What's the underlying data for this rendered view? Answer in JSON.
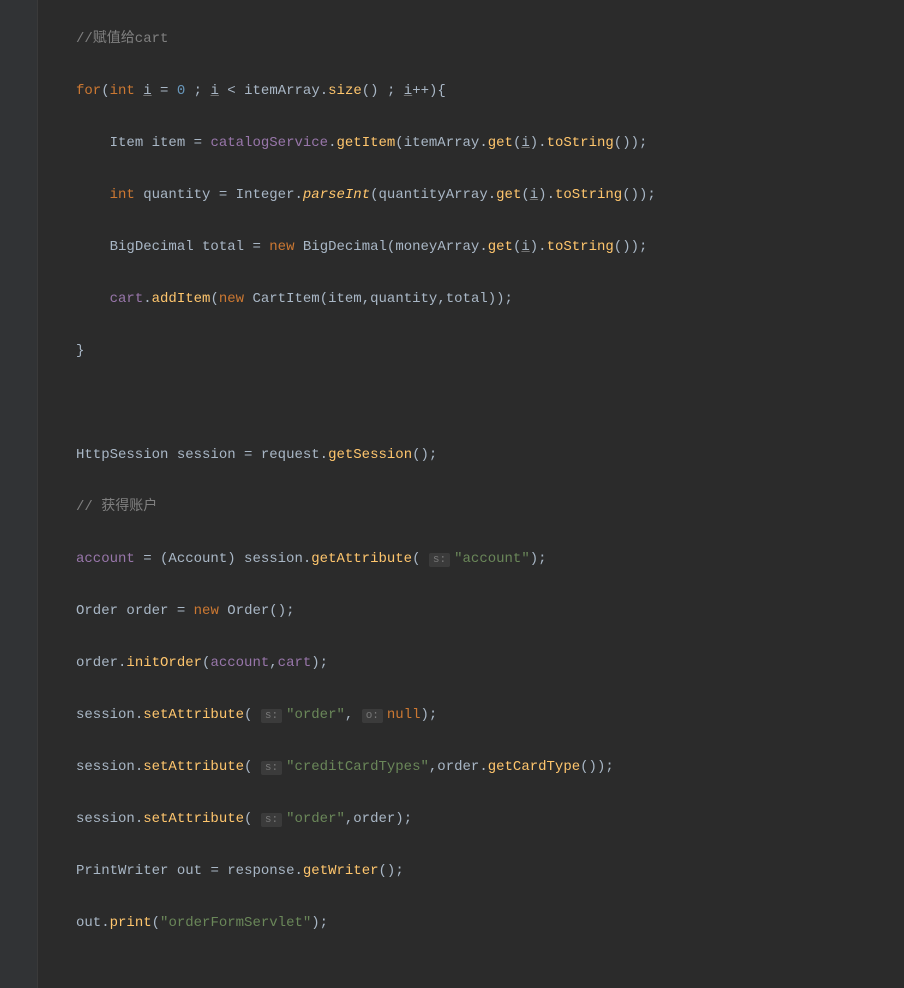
{
  "code": {
    "l1": {
      "comment": "//赋值给cart"
    },
    "l2": {
      "kw_for": "for",
      "p1": "(",
      "kw_int": "int",
      "var_i": "i",
      "eq": " = ",
      "zero": "0",
      "sep1": " ; ",
      "var_i2": "i",
      "lt": " < ",
      "itemArray": "itemArray",
      "dot1": ".",
      "size": "size",
      "call1": "()",
      "sep2": " ; ",
      "var_i3": "i",
      "inc": "++",
      "close": "){"
    },
    "l3": {
      "type": "Item ",
      "var": "item",
      "eq": " = ",
      "svc": "catalogService",
      "dot": ".",
      "m": "getItem",
      "p1": "(",
      "arr": "itemArray",
      "dot2": ".",
      "get": "get",
      "p2": "(",
      "i": "i",
      "p3": ").",
      "ts": "toString",
      "p4": "());"
    },
    "l4": {
      "kw": "int",
      "var": " quantity",
      "eq": " = ",
      "cls": "Integer",
      "dot": ".",
      "m": "parseInt",
      "p1": "(",
      "arr": "quantityArray",
      "dot2": ".",
      "get": "get",
      "p2": "(",
      "i": "i",
      "p3": ").",
      "ts": "toString",
      "p4": "());"
    },
    "l5": {
      "type": "BigDecimal ",
      "var": "total",
      "eq": " = ",
      "kw": "new",
      "sp": " ",
      "cls": "BigDecimal",
      "p1": "(",
      "arr": "moneyArray",
      "dot2": ".",
      "get": "get",
      "p2": "(",
      "i": "i",
      "p3": ").",
      "ts": "toString",
      "p4": "());"
    },
    "l6": {
      "cart": "cart",
      "dot": ".",
      "m": "addItem",
      "p1": "(",
      "kw": "new",
      "sp": " ",
      "cls": "CartItem",
      "p2": "(",
      "a1": "item",
      "c1": ",",
      "a2": "quantity",
      "c2": ",",
      "a3": "total",
      "p3": "));"
    },
    "l7": {
      "brace": "}"
    },
    "l8": {
      "blank": ""
    },
    "l9": {
      "type": "HttpSession ",
      "var": "session",
      "eq": " = ",
      "req": "request",
      "dot": ".",
      "m": "getSession",
      "p": "();"
    },
    "l10": {
      "comment": "// 获得账户"
    },
    "l11": {
      "acct": "account",
      "eq": " = (",
      "cls": "Account",
      "p1": ") ",
      "sess": "session",
      "dot": ".",
      "m": "getAttribute",
      "p2": "( ",
      "hint": "s:",
      "str": "\"account\"",
      "p3": ");"
    },
    "l12": {
      "type": "Order ",
      "var": "order",
      "eq": " = ",
      "kw": "new",
      "sp": " ",
      "cls": "Order",
      "p": "();"
    },
    "l13": {
      "var": "order",
      "dot": ".",
      "m": "initOrder",
      "p1": "(",
      "a1": "account",
      "c": ",",
      "a2": "cart",
      "p2": ");"
    },
    "l14": {
      "sess": "session",
      "dot": ".",
      "m": "setAttribute",
      "p1": "( ",
      "hint1": "s:",
      "str": "\"order\"",
      "c": ", ",
      "hint2": "o:",
      "nul": "null",
      "p2": ");"
    },
    "l15": {
      "sess": "session",
      "dot": ".",
      "m": "setAttribute",
      "p1": "( ",
      "hint": "s:",
      "str": "\"creditCardTypes\"",
      "c": ",",
      "var": "order",
      "dot2": ".",
      "m2": "getCardType",
      "p2": "());"
    },
    "l16": {
      "sess": "session",
      "dot": ".",
      "m": "setAttribute",
      "p1": "( ",
      "hint": "s:",
      "str": "\"order\"",
      "c": ",",
      "var": "order",
      "p2": ");"
    },
    "l17": {
      "type": "PrintWriter ",
      "var": "out",
      "eq": " = ",
      "resp": "response",
      "dot": ".",
      "m": "getWriter",
      "p": "();"
    },
    "l18": {
      "var": "out",
      "dot": ".",
      "m": "print",
      "p1": "(",
      "str": "\"orderFormServlet\"",
      "p2": ");"
    }
  }
}
